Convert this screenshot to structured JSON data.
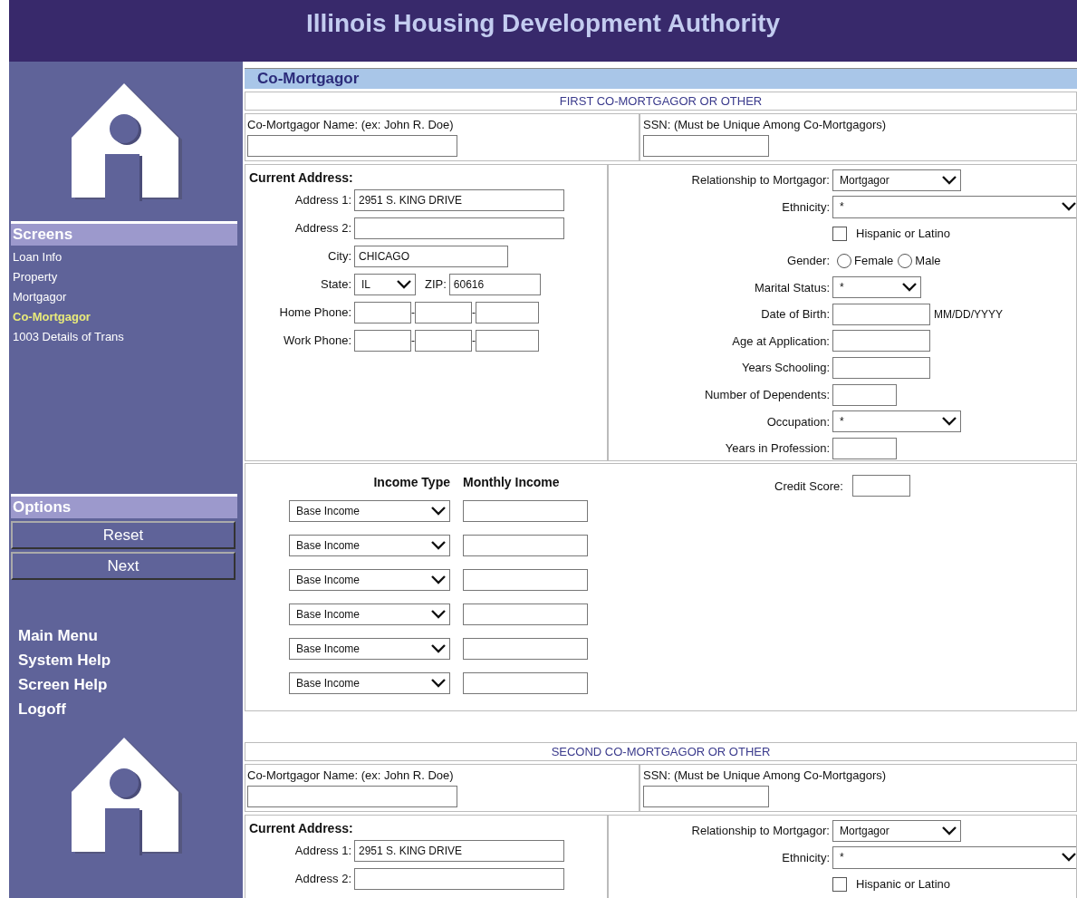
{
  "header": {
    "title": "Illinois Housing Development Authority"
  },
  "sidebar": {
    "screens_heading": "Screens",
    "screens": [
      {
        "label": "Loan Info",
        "selected": false
      },
      {
        "label": "Property",
        "selected": false
      },
      {
        "label": "Mortgagor",
        "selected": false
      },
      {
        "label": "Co-Mortgagor",
        "selected": true
      },
      {
        "label": "1003 Details of Trans",
        "selected": false
      }
    ],
    "options_heading": "Options",
    "buttons": [
      "Reset",
      "Next"
    ],
    "links": [
      "Main Menu",
      "System Help",
      "Screen Help",
      "Logoff"
    ]
  },
  "page_title": "Co-Mortgagor",
  "sections": [
    {
      "heading": "FIRST CO-MORTGAGOR OR OTHER",
      "name_label": "Co-Mortgagor Name: (ex: John R. Doe)",
      "ssn_label": "SSN: (Must be Unique Among Co-Mortgagors)",
      "address_heading": "Current Address:",
      "address_rows": [
        {
          "kind": "street",
          "label": "Address 1:",
          "value": "2951 S. KING DRIVE"
        },
        {
          "kind": "street",
          "label": "Address 2:"
        },
        {
          "kind": "city",
          "label": "City:",
          "value": "CHICAGO"
        },
        {
          "kind": "statezip",
          "label": "State:",
          "value": "IL",
          "zip_label": "ZIP:",
          "zip": "60616"
        },
        {
          "kind": "phone",
          "label": "Home Phone:",
          "separators": [
            "-",
            "-"
          ]
        },
        {
          "kind": "phone",
          "label": "Work Phone:",
          "separators": [
            "-",
            "-"
          ]
        }
      ],
      "details": [
        {
          "kind": "select",
          "label": "Relationship to Mortgagor:",
          "value": "Mortgagor"
        },
        {
          "kind": "wideselect",
          "label": "Ethnicity:",
          "value": "*"
        },
        {
          "kind": "checkbox",
          "label": "Hispanic or Latino",
          "checked": false
        },
        {
          "kind": "radio",
          "label": "Gender:",
          "options": [
            {
              "label": "Female",
              "selected": false
            },
            {
              "label": "Male",
              "selected": false
            }
          ]
        },
        {
          "kind": "shortselect",
          "label": "Marital Status:",
          "value": "*"
        },
        {
          "kind": "date",
          "label": "Date of Birth:",
          "hint": "MM/DD/YYYY"
        },
        {
          "kind": "field",
          "label": "Age at Application:"
        },
        {
          "kind": "field",
          "label": "Years Schooling:"
        },
        {
          "kind": "shortfield",
          "label": "Number of Dependents:"
        },
        {
          "kind": "select",
          "label": "Occupation:",
          "value": "*"
        },
        {
          "kind": "shortfield",
          "label": "Years in Profession:"
        }
      ],
      "income": {
        "columns": [
          "Income Type",
          "Monthly Income"
        ],
        "rows": [
          {
            "type": "Base Income"
          },
          {
            "type": "Base Income"
          },
          {
            "type": "Base Income"
          },
          {
            "type": "Base Income"
          },
          {
            "type": "Base Income"
          },
          {
            "type": "Base Income"
          }
        ],
        "credit_label": "Credit Score:"
      }
    },
    {
      "heading": "SECOND CO-MORTGAGOR OR OTHER",
      "name_label": "Co-Mortgagor Name: (ex: John R. Doe)",
      "ssn_label": "SSN: (Must be Unique Among Co-Mortgagors)",
      "address_heading": "Current Address:",
      "address_rows": [
        {
          "kind": "street",
          "label": "Address 1:",
          "value": "2951 S. KING DRIVE"
        },
        {
          "kind": "street",
          "label": "Address 2:"
        }
      ],
      "details": [
        {
          "kind": "select",
          "label": "Relationship to Mortgagor:",
          "value": "Mortgagor"
        },
        {
          "kind": "wideselect",
          "label": "Ethnicity:",
          "value": "*"
        },
        {
          "kind": "checkbox",
          "label": "Hispanic or Latino",
          "checked": false
        }
      ]
    }
  ]
}
